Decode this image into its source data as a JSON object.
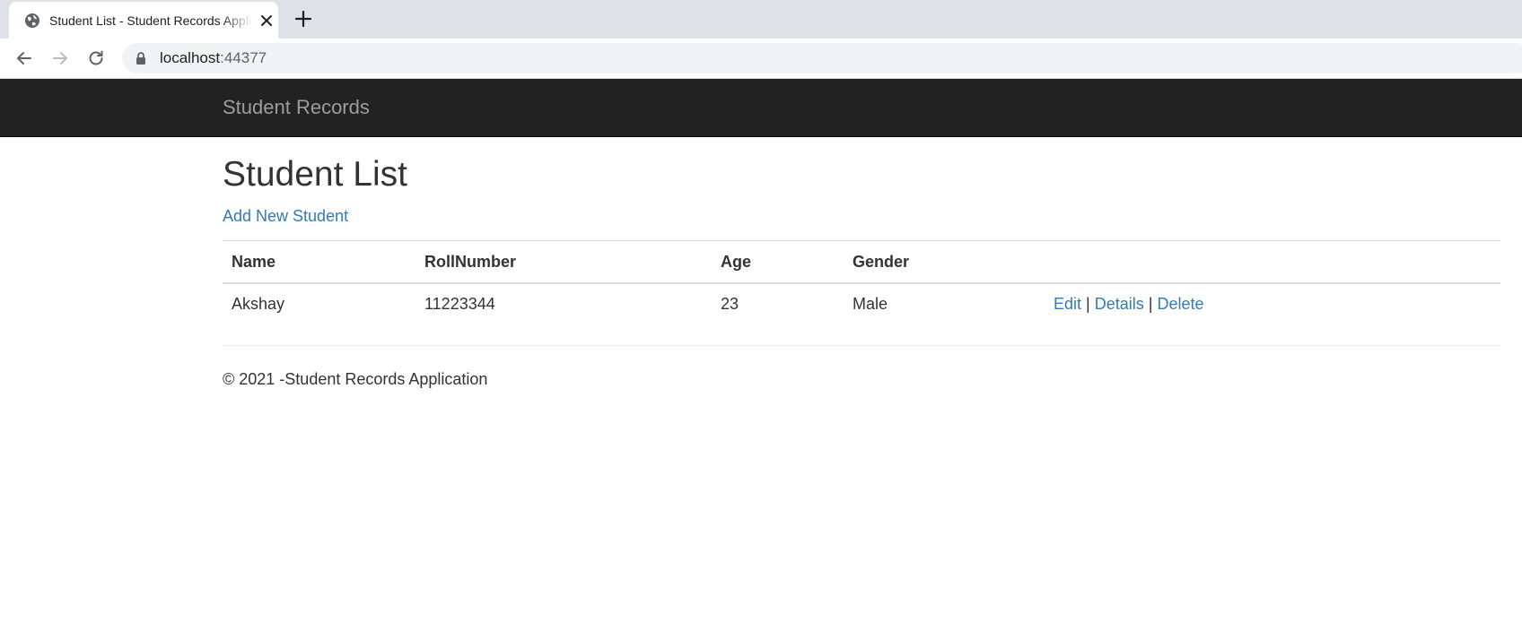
{
  "browser": {
    "tab_title": "Student List - Student Records Application",
    "url_host": "localhost",
    "url_port": ":44377"
  },
  "navbar": {
    "brand": "Student Records"
  },
  "main": {
    "title": "Student List",
    "add_link": "Add New Student",
    "table": {
      "headers": [
        "Name",
        "RollNumber",
        "Age",
        "Gender"
      ],
      "rows": [
        {
          "name": "Akshay",
          "roll_number": "11223344",
          "age": "23",
          "gender": "Male",
          "actions": {
            "edit": "Edit",
            "details": "Details",
            "delete": "Delete",
            "separator": "|"
          }
        }
      ]
    }
  },
  "footer": {
    "text": "© 2021 -Student Records Application"
  },
  "colors": {
    "navbar_bg": "#222222",
    "brand_text": "#9d9d9d",
    "link": "#337ab7",
    "body_text": "#333333",
    "tabstrip_bg": "#dee1e6"
  },
  "icons": {
    "favicon": "globe-icon",
    "tab_close": "close-icon",
    "new_tab": "plus-icon",
    "back": "back-arrow-icon",
    "forward": "forward-arrow-icon",
    "reload": "reload-icon",
    "secure": "lock-icon"
  }
}
